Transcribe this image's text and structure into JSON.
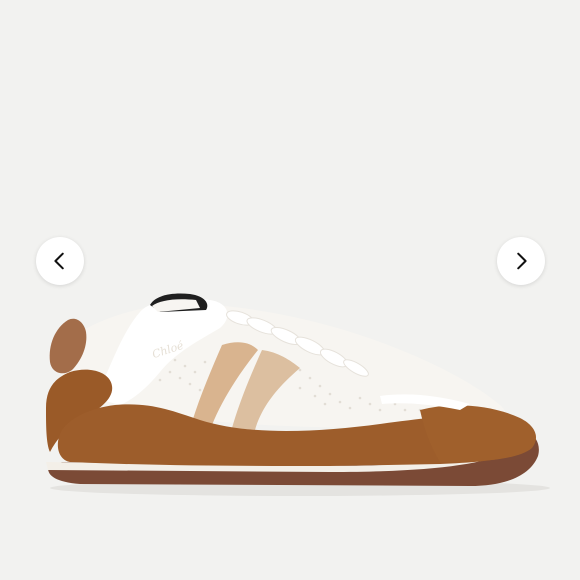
{
  "gallery": {
    "image_subject": "sneaker-photo",
    "brand_embossing": "Chloé",
    "prev_icon": "chevron-left-icon",
    "next_icon": "chevron-right-icon",
    "colors": {
      "background": "#f2f2f0",
      "button_bg": "#ffffff",
      "suede": "#9a5a28",
      "outsole": "#7b4a36",
      "leather_tan": "#d9b48f",
      "mesh_white": "#f7f5f1"
    }
  }
}
